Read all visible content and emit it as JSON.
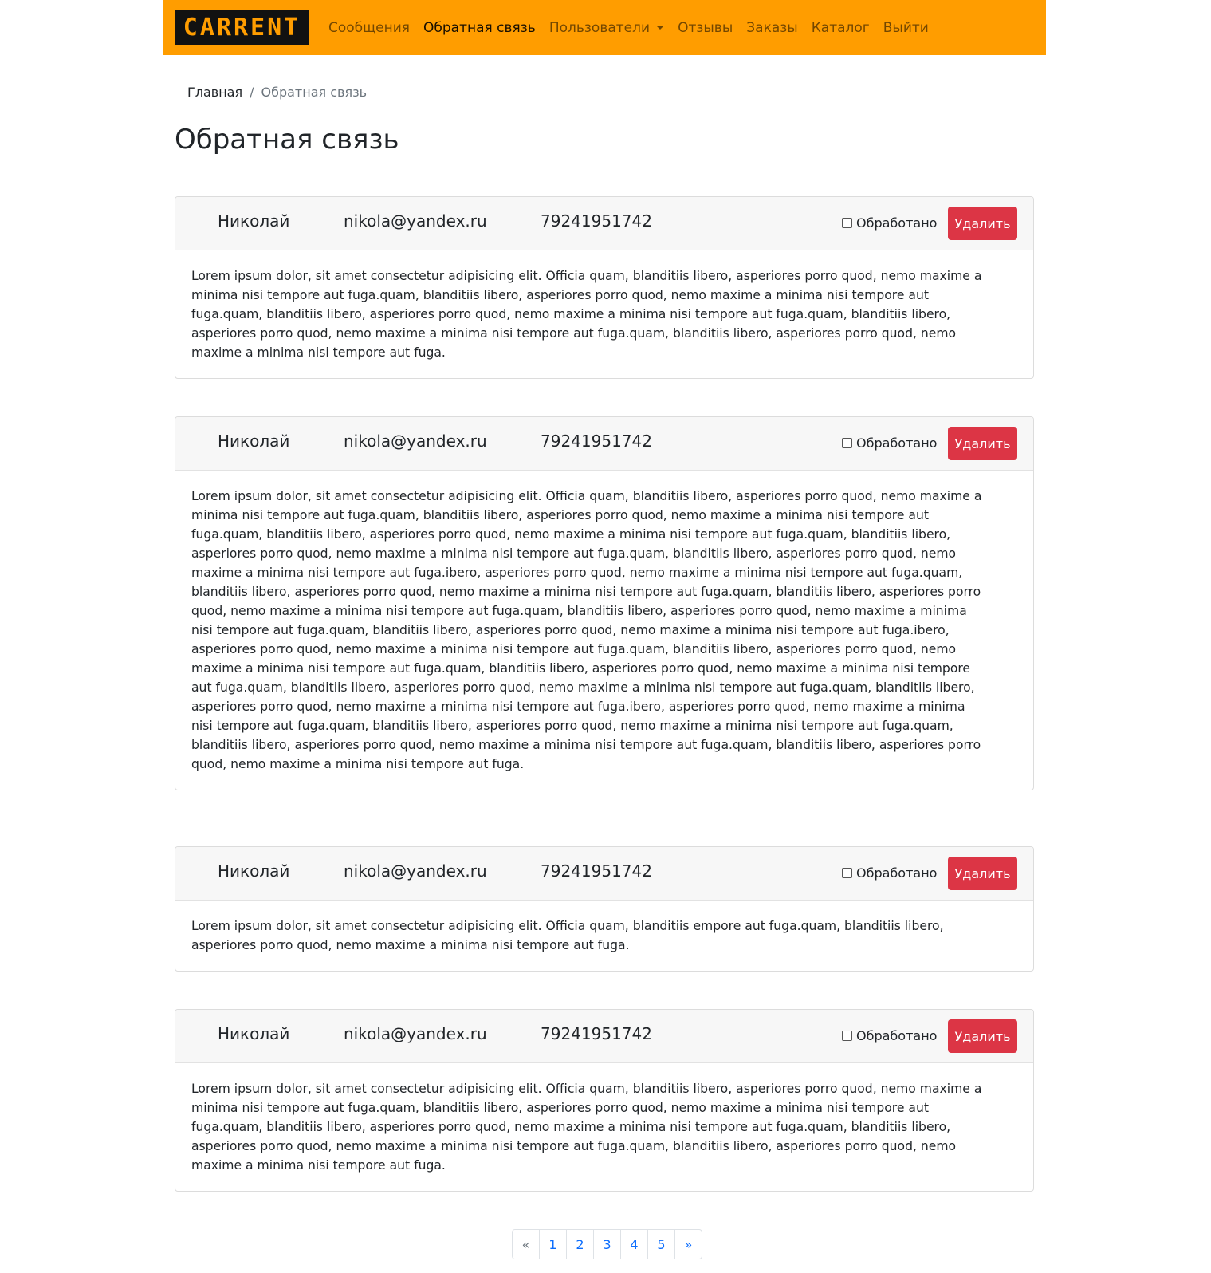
{
  "brand": {
    "logo": "CARRENT"
  },
  "nav": {
    "items": [
      {
        "label": "Сообщения"
      },
      {
        "label": "Обратная связь"
      },
      {
        "label": "Пользователи"
      },
      {
        "label": "Отзывы"
      },
      {
        "label": "Заказы"
      },
      {
        "label": "Каталог"
      },
      {
        "label": "Выйти"
      }
    ]
  },
  "breadcrumb": {
    "home": "Главная",
    "separator": "/",
    "current": "Обратная связь"
  },
  "page": {
    "title": "Обратная связь"
  },
  "feedback": [
    {
      "name": "Николай",
      "email": "nikola@yandex.ru",
      "phone": "79241951742",
      "processed_label": "Обработано",
      "delete_label": "Удалить",
      "message": "Lorem ipsum dolor, sit amet consectetur adipisicing elit. Officia quam, blanditiis libero, asperiores porro quod, nemo maxime a minima nisi tempore aut fuga.quam, blanditiis libero, asperiores porro quod, nemo maxime a minima nisi tempore aut fuga.quam, blanditiis libero, asperiores porro quod, nemo maxime a minima nisi tempore aut fuga.quam, blanditiis libero, asperiores porro quod, nemo maxime a minima nisi tempore aut fuga.quam, blanditiis libero, asperiores porro quod, nemo maxime a minima nisi tempore aut fuga."
    },
    {
      "name": "Николай",
      "email": "nikola@yandex.ru",
      "phone": "79241951742",
      "processed_label": "Обработано",
      "delete_label": "Удалить",
      "message": "Lorem ipsum dolor, sit amet consectetur adipisicing elit. Officia quam, blanditiis libero, asperiores porro quod, nemo maxime a minima nisi tempore aut fuga.quam, blanditiis libero, asperiores porro quod, nemo maxime a minima nisi tempore aut fuga.quam, blanditiis libero, asperiores porro quod, nemo maxime a minima nisi tempore aut fuga.quam, blanditiis libero, asperiores porro quod, nemo maxime a minima nisi tempore aut fuga.quam, blanditiis libero, asperiores porro quod, nemo maxime a minima nisi tempore aut fuga.ibero, asperiores porro quod, nemo maxime a minima nisi tempore aut fuga.quam, blanditiis libero, asperiores porro quod, nemo maxime a minima nisi tempore aut fuga.quam, blanditiis libero, asperiores porro quod, nemo maxime a minima nisi tempore aut fuga.quam, blanditiis libero, asperiores porro quod, nemo maxime a minima nisi tempore aut fuga.quam, blanditiis libero, asperiores porro quod, nemo maxime a minima nisi tempore aut fuga.ibero, asperiores porro quod, nemo maxime a minima nisi tempore aut fuga.quam, blanditiis libero, asperiores porro quod, nemo maxime a minima nisi tempore aut fuga.quam, blanditiis libero, asperiores porro quod, nemo maxime a minima nisi tempore aut fuga.quam, blanditiis libero, asperiores porro quod, nemo maxime a minima nisi tempore aut fuga.quam, blanditiis libero, asperiores porro quod, nemo maxime a minima nisi tempore aut fuga.ibero, asperiores porro quod, nemo maxime a minima nisi tempore aut fuga.quam, blanditiis libero, asperiores porro quod, nemo maxime a minima nisi tempore aut fuga.quam, blanditiis libero, asperiores porro quod, nemo maxime a minima nisi tempore aut fuga.quam, blanditiis libero, asperiores porro quod, nemo maxime a minima nisi tempore aut fuga."
    },
    {
      "name": "Николай",
      "email": "nikola@yandex.ru",
      "phone": "79241951742",
      "processed_label": "Обработано",
      "delete_label": "Удалить",
      "message": "Lorem ipsum dolor, sit amet consectetur adipisicing elit. Officia quam, blanditiis empore aut fuga.quam, blanditiis libero, asperiores porro quod, nemo maxime a minima nisi tempore aut fuga."
    },
    {
      "name": "Николай",
      "email": "nikola@yandex.ru",
      "phone": "79241951742",
      "processed_label": "Обработано",
      "delete_label": "Удалить",
      "message": "Lorem ipsum dolor, sit amet consectetur adipisicing elit. Officia quam, blanditiis libero, asperiores porro quod, nemo maxime a minima nisi tempore aut fuga.quam, blanditiis libero, asperiores porro quod, nemo maxime a minima nisi tempore aut fuga.quam, blanditiis libero, asperiores porro quod, nemo maxime a minima nisi tempore aut fuga.quam, blanditiis libero, asperiores porro quod, nemo maxime a minima nisi tempore aut fuga.quam, blanditiis libero, asperiores porro quod, nemo maxime a minima nisi tempore aut fuga."
    }
  ],
  "pagination": {
    "prev": "«",
    "pages": [
      "1",
      "2",
      "3",
      "4",
      "5"
    ],
    "next": "»"
  },
  "colors": {
    "navbar": "#ff9d00",
    "logo_bg": "#111111",
    "delete_button": "#dc3545",
    "link": "#0d6efd"
  }
}
